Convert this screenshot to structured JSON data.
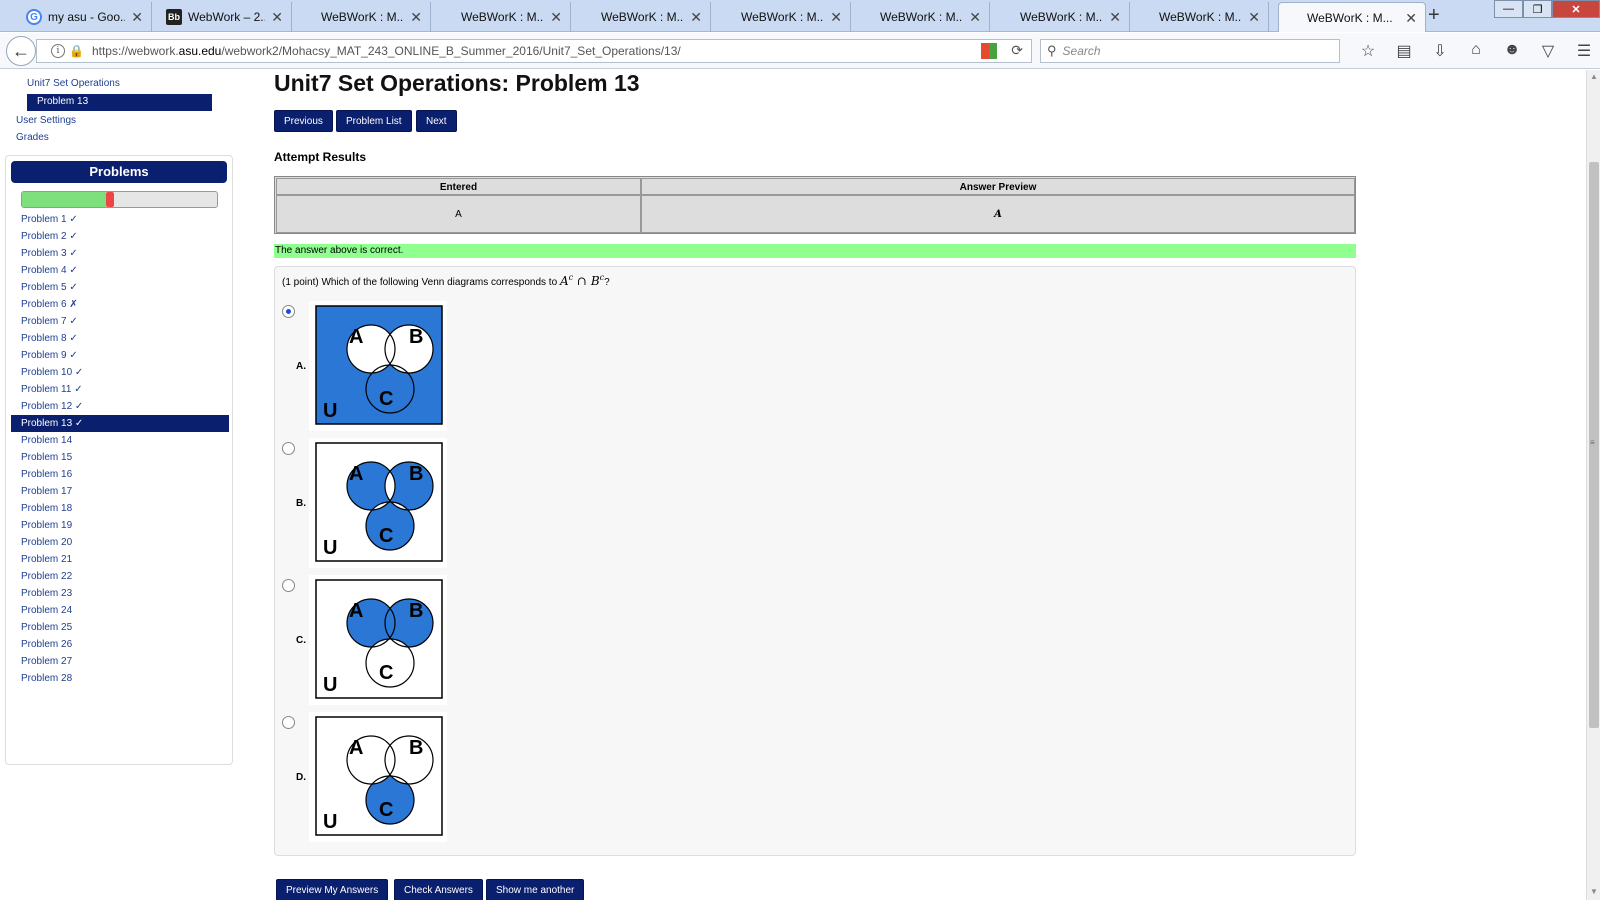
{
  "browser": {
    "tabs": [
      {
        "title": "my asu - Goo...",
        "icon": "google-icon"
      },
      {
        "title": "WebWork – 2...",
        "icon": "blackboard-icon"
      },
      {
        "title": "WeBWorK : M...",
        "icon": ""
      },
      {
        "title": "WeBWorK : M...",
        "icon": ""
      },
      {
        "title": "WeBWorK : M...",
        "icon": ""
      },
      {
        "title": "WeBWorK : M...",
        "icon": ""
      },
      {
        "title": "WeBWorK : M...",
        "icon": ""
      },
      {
        "title": "WeBWorK : M...",
        "icon": ""
      },
      {
        "title": "WeBWorK : M...",
        "icon": ""
      },
      {
        "title": "WeBWorK : M...",
        "icon": "",
        "active": true
      }
    ],
    "url_prefix": "https://webwork.",
    "url_domain": "asu.edu",
    "url_path": "/webwork2/Mohacsy_MAT_243_ONLINE_B_Summer_2016/Unit7_Set_Operations/13/",
    "search_placeholder": "Search"
  },
  "sidebar": {
    "set_link": "Unit7 Set Operations",
    "active_problem": "Problem 13",
    "user_settings": "User Settings",
    "grades": "Grades",
    "problems_header": "Problems",
    "progress": {
      "correct_fraction": 0.43,
      "incorrect_fraction": 0.04
    },
    "problems": [
      {
        "label": "Problem 1",
        "status": "✓"
      },
      {
        "label": "Problem 2",
        "status": "✓"
      },
      {
        "label": "Problem 3",
        "status": "✓"
      },
      {
        "label": "Problem 4",
        "status": "✓"
      },
      {
        "label": "Problem 5",
        "status": "✓"
      },
      {
        "label": "Problem 6",
        "status": "✗"
      },
      {
        "label": "Problem 7",
        "status": "✓"
      },
      {
        "label": "Problem 8",
        "status": "✓"
      },
      {
        "label": "Problem 9",
        "status": "✓"
      },
      {
        "label": "Problem 10",
        "status": "✓"
      },
      {
        "label": "Problem 11",
        "status": "✓"
      },
      {
        "label": "Problem 12",
        "status": "✓"
      },
      {
        "label": "Problem 13",
        "status": "✓",
        "current": true
      },
      {
        "label": "Problem 14",
        "status": ""
      },
      {
        "label": "Problem 15",
        "status": ""
      },
      {
        "label": "Problem 16",
        "status": ""
      },
      {
        "label": "Problem 17",
        "status": ""
      },
      {
        "label": "Problem 18",
        "status": ""
      },
      {
        "label": "Problem 19",
        "status": ""
      },
      {
        "label": "Problem 20",
        "status": ""
      },
      {
        "label": "Problem 21",
        "status": ""
      },
      {
        "label": "Problem 22",
        "status": ""
      },
      {
        "label": "Problem 23",
        "status": ""
      },
      {
        "label": "Problem 24",
        "status": ""
      },
      {
        "label": "Problem 25",
        "status": ""
      },
      {
        "label": "Problem 26",
        "status": ""
      },
      {
        "label": "Problem 27",
        "status": ""
      },
      {
        "label": "Problem 28",
        "status": ""
      }
    ]
  },
  "main": {
    "title": "Unit7 Set Operations: Problem 13",
    "nav": {
      "previous": "Previous",
      "problem_list": "Problem List",
      "next": "Next"
    },
    "attempt_results_title": "Attempt Results",
    "results_table": {
      "headers": [
        "Entered",
        "Answer Preview"
      ],
      "entered": "A",
      "preview": "A"
    },
    "correct_message": "The answer above is correct.",
    "question": {
      "prefix": "(1 point) Which of the following Venn diagrams corresponds to ",
      "math_a": "A",
      "math_b": "B",
      "sup": "c",
      "op": "∩",
      "suffix": "?"
    },
    "options": [
      {
        "label": "A.",
        "selected": true,
        "shaded": "outside-AB"
      },
      {
        "label": "B.",
        "selected": false,
        "shaded": "symmetric-difference"
      },
      {
        "label": "C.",
        "selected": false,
        "shaded": "A-union-B-minus-C"
      },
      {
        "label": "D.",
        "selected": false,
        "shaded": "C-only"
      }
    ],
    "venn_labels": {
      "a": "A",
      "b": "B",
      "c": "C",
      "u": "U"
    },
    "shade_color": "#2a77d6",
    "buttons": {
      "preview": "Preview My Answers",
      "check": "Check Answers",
      "another": "Show me another"
    }
  }
}
